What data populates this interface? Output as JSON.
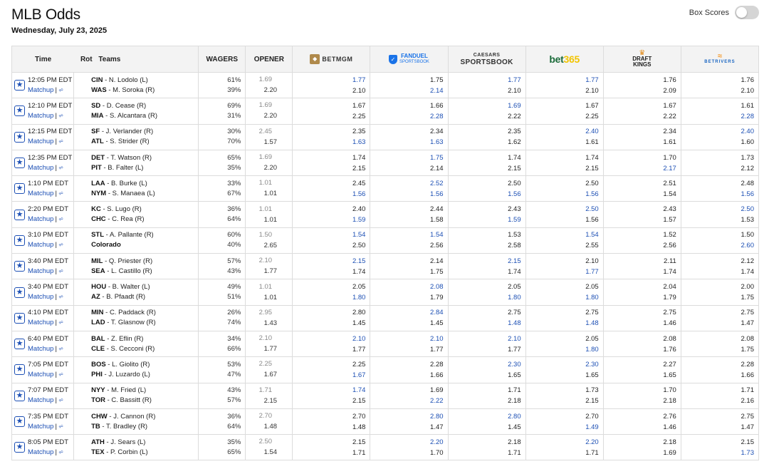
{
  "page": {
    "title": "MLB Odds",
    "date": "Wednesday, July 23, 2025"
  },
  "box_scores": {
    "label": "Box Scores",
    "enabled": false
  },
  "columns": {
    "time": "Time",
    "rot": "Rot",
    "teams": "Teams",
    "wagers": "WAGERS",
    "opener": "OPENER",
    "books": [
      {
        "name": "BetMGM",
        "icon": "betmgm-logo-icon",
        "text": "BETMGM"
      },
      {
        "name": "FanDuel Sportsbook",
        "icon": "fanduel-logo-icon",
        "text": "FANDUEL",
        "sub": "SPORTSBOOK"
      },
      {
        "name": "Caesars Sportsbook",
        "icon": "caesars-logo-icon",
        "text": "CAESARS",
        "sub": "SPORTSBOOK"
      },
      {
        "name": "bet365",
        "icon": "bet365-logo-icon",
        "text": "bet",
        "sub": "365"
      },
      {
        "name": "DraftKings",
        "icon": "draftkings-logo-icon",
        "text": "DRAFT",
        "sub": "KINGS"
      },
      {
        "name": "BetRivers",
        "icon": "betrivers-logo-icon",
        "text": "BETRIVERS"
      }
    ]
  },
  "matchup_label": "Matchup",
  "colors": {
    "accent": "#1c4fb4",
    "header_bg": "#f3f3f3",
    "border": "#dcdcdc"
  },
  "games": [
    {
      "time": "12:05 PM EDT",
      "away": {
        "abbr": "CIN",
        "pitcher": " - N. Lodolo (L)"
      },
      "home": {
        "abbr": "WAS",
        "pitcher": " - M. Soroka (R)"
      },
      "wagers": [
        "61%",
        "39%"
      ],
      "opener": [
        "1.69",
        "2.20"
      ],
      "odds": [
        [
          "1.77",
          "2.10"
        ],
        [
          "1.75",
          "2.14"
        ],
        [
          "1.77",
          "2.10"
        ],
        [
          "1.77",
          "2.10"
        ],
        [
          "1.76",
          "2.09"
        ],
        [
          "1.76",
          "2.10"
        ]
      ],
      "best": [
        [
          1,
          0
        ],
        [
          0,
          1
        ],
        [
          1,
          0
        ],
        [
          1,
          0
        ],
        [
          0,
          0
        ],
        [
          0,
          0
        ]
      ]
    },
    {
      "time": "12:10 PM EDT",
      "away": {
        "abbr": "SD",
        "pitcher": " - D. Cease (R)"
      },
      "home": {
        "abbr": "MIA",
        "pitcher": " - S. Alcantara (R)"
      },
      "wagers": [
        "69%",
        "31%"
      ],
      "opener": [
        "1.69",
        "2.20"
      ],
      "odds": [
        [
          "1.67",
          "2.25"
        ],
        [
          "1.66",
          "2.28"
        ],
        [
          "1.69",
          "2.22"
        ],
        [
          "1.67",
          "2.25"
        ],
        [
          "1.67",
          "2.22"
        ],
        [
          "1.61",
          "2.28"
        ]
      ],
      "best": [
        [
          0,
          0
        ],
        [
          0,
          1
        ],
        [
          1,
          0
        ],
        [
          0,
          0
        ],
        [
          0,
          0
        ],
        [
          0,
          1
        ]
      ]
    },
    {
      "time": "12:15 PM EDT",
      "away": {
        "abbr": "SF",
        "pitcher": " - J. Verlander (R)"
      },
      "home": {
        "abbr": "ATL",
        "pitcher": " - S. Strider (R)"
      },
      "wagers": [
        "30%",
        "70%"
      ],
      "opener": [
        "2.45",
        "1.57"
      ],
      "odds": [
        [
          "2.35",
          "1.63"
        ],
        [
          "2.34",
          "1.63"
        ],
        [
          "2.35",
          "1.62"
        ],
        [
          "2.40",
          "1.61"
        ],
        [
          "2.34",
          "1.61"
        ],
        [
          "2.40",
          "1.60"
        ]
      ],
      "best": [
        [
          0,
          1
        ],
        [
          0,
          1
        ],
        [
          0,
          0
        ],
        [
          1,
          0
        ],
        [
          0,
          0
        ],
        [
          1,
          0
        ]
      ]
    },
    {
      "time": "12:35 PM EDT",
      "away": {
        "abbr": "DET",
        "pitcher": " - T. Watson (R)"
      },
      "home": {
        "abbr": "PIT",
        "pitcher": " - B. Falter (L)"
      },
      "wagers": [
        "65%",
        "35%"
      ],
      "opener": [
        "1.69",
        "2.20"
      ],
      "odds": [
        [
          "1.74",
          "2.15"
        ],
        [
          "1.75",
          "2.14"
        ],
        [
          "1.74",
          "2.15"
        ],
        [
          "1.74",
          "2.15"
        ],
        [
          "1.70",
          "2.17"
        ],
        [
          "1.73",
          "2.12"
        ]
      ],
      "best": [
        [
          0,
          0
        ],
        [
          1,
          0
        ],
        [
          0,
          0
        ],
        [
          0,
          0
        ],
        [
          0,
          1
        ],
        [
          0,
          0
        ]
      ]
    },
    {
      "time": "1:10 PM EDT",
      "away": {
        "abbr": "LAA",
        "pitcher": " - B. Burke (L)"
      },
      "home": {
        "abbr": "NYM",
        "pitcher": " - S. Manaea (L)"
      },
      "wagers": [
        "33%",
        "67%"
      ],
      "opener": [
        "1.01",
        "1.01"
      ],
      "odds": [
        [
          "2.45",
          "1.56"
        ],
        [
          "2.52",
          "1.56"
        ],
        [
          "2.50",
          "1.56"
        ],
        [
          "2.50",
          "1.56"
        ],
        [
          "2.51",
          "1.54"
        ],
        [
          "2.48",
          "1.56"
        ]
      ],
      "best": [
        [
          0,
          1
        ],
        [
          1,
          1
        ],
        [
          0,
          1
        ],
        [
          0,
          1
        ],
        [
          0,
          0
        ],
        [
          0,
          1
        ]
      ]
    },
    {
      "time": "2:20 PM EDT",
      "away": {
        "abbr": "KC",
        "pitcher": " - S. Lugo (R)"
      },
      "home": {
        "abbr": "CHC",
        "pitcher": " - C. Rea (R)"
      },
      "wagers": [
        "36%",
        "64%"
      ],
      "opener": [
        "1.01",
        "1.01"
      ],
      "odds": [
        [
          "2.40",
          "1.59"
        ],
        [
          "2.44",
          "1.58"
        ],
        [
          "2.43",
          "1.59"
        ],
        [
          "2.50",
          "1.56"
        ],
        [
          "2.43",
          "1.57"
        ],
        [
          "2.50",
          "1.53"
        ]
      ],
      "best": [
        [
          0,
          1
        ],
        [
          0,
          0
        ],
        [
          0,
          1
        ],
        [
          1,
          0
        ],
        [
          0,
          0
        ],
        [
          1,
          0
        ]
      ]
    },
    {
      "time": "3:10 PM EDT",
      "away": {
        "abbr": "STL",
        "pitcher": " - A. Pallante (R)"
      },
      "home": {
        "abbr": "Colorado",
        "pitcher": ""
      },
      "wagers": [
        "60%",
        "40%"
      ],
      "opener": [
        "1.50",
        "2.65"
      ],
      "odds": [
        [
          "1.54",
          "2.50"
        ],
        [
          "1.54",
          "2.56"
        ],
        [
          "1.53",
          "2.58"
        ],
        [
          "1.54",
          "2.55"
        ],
        [
          "1.52",
          "2.56"
        ],
        [
          "1.50",
          "2.60"
        ]
      ],
      "best": [
        [
          1,
          0
        ],
        [
          1,
          0
        ],
        [
          0,
          0
        ],
        [
          1,
          0
        ],
        [
          0,
          0
        ],
        [
          0,
          1
        ]
      ]
    },
    {
      "time": "3:40 PM EDT",
      "away": {
        "abbr": "MIL",
        "pitcher": " - Q. Priester (R)"
      },
      "home": {
        "abbr": "SEA",
        "pitcher": " - L. Castillo (R)"
      },
      "wagers": [
        "57%",
        "43%"
      ],
      "opener": [
        "2.10",
        "1.77"
      ],
      "odds": [
        [
          "2.15",
          "1.74"
        ],
        [
          "2.14",
          "1.75"
        ],
        [
          "2.15",
          "1.74"
        ],
        [
          "2.10",
          "1.77"
        ],
        [
          "2.11",
          "1.74"
        ],
        [
          "2.12",
          "1.74"
        ]
      ],
      "best": [
        [
          1,
          0
        ],
        [
          0,
          0
        ],
        [
          1,
          0
        ],
        [
          0,
          1
        ],
        [
          0,
          0
        ],
        [
          0,
          0
        ]
      ]
    },
    {
      "time": "3:40 PM EDT",
      "away": {
        "abbr": "HOU",
        "pitcher": " - B. Walter (L)"
      },
      "home": {
        "abbr": "AZ",
        "pitcher": " - B. Pfaadt (R)"
      },
      "wagers": [
        "49%",
        "51%"
      ],
      "opener": [
        "1.01",
        "1.01"
      ],
      "odds": [
        [
          "2.05",
          "1.80"
        ],
        [
          "2.08",
          "1.79"
        ],
        [
          "2.05",
          "1.80"
        ],
        [
          "2.05",
          "1.80"
        ],
        [
          "2.04",
          "1.79"
        ],
        [
          "2.00",
          "1.75"
        ]
      ],
      "best": [
        [
          0,
          1
        ],
        [
          1,
          0
        ],
        [
          0,
          1
        ],
        [
          0,
          1
        ],
        [
          0,
          0
        ],
        [
          0,
          0
        ]
      ]
    },
    {
      "time": "4:10 PM EDT",
      "away": {
        "abbr": "MIN",
        "pitcher": " - C. Paddack (R)"
      },
      "home": {
        "abbr": "LAD",
        "pitcher": " - T. Glasnow (R)"
      },
      "wagers": [
        "26%",
        "74%"
      ],
      "opener": [
        "2.95",
        "1.43"
      ],
      "odds": [
        [
          "2.80",
          "1.45"
        ],
        [
          "2.84",
          "1.45"
        ],
        [
          "2.75",
          "1.48"
        ],
        [
          "2.75",
          "1.48"
        ],
        [
          "2.75",
          "1.46"
        ],
        [
          "2.75",
          "1.47"
        ]
      ],
      "best": [
        [
          0,
          0
        ],
        [
          1,
          0
        ],
        [
          0,
          1
        ],
        [
          0,
          1
        ],
        [
          0,
          0
        ],
        [
          0,
          0
        ]
      ]
    },
    {
      "time": "6:40 PM EDT",
      "away": {
        "abbr": "BAL",
        "pitcher": " - Z. Eflin (R)"
      },
      "home": {
        "abbr": "CLE",
        "pitcher": " - S. Cecconi (R)"
      },
      "wagers": [
        "34%",
        "66%"
      ],
      "opener": [
        "2.10",
        "1.77"
      ],
      "odds": [
        [
          "2.10",
          "1.77"
        ],
        [
          "2.10",
          "1.77"
        ],
        [
          "2.10",
          "1.77"
        ],
        [
          "2.05",
          "1.80"
        ],
        [
          "2.08",
          "1.76"
        ],
        [
          "2.08",
          "1.75"
        ]
      ],
      "best": [
        [
          1,
          0
        ],
        [
          1,
          0
        ],
        [
          1,
          0
        ],
        [
          0,
          1
        ],
        [
          0,
          0
        ],
        [
          0,
          0
        ]
      ]
    },
    {
      "time": "7:05 PM EDT",
      "away": {
        "abbr": "BOS",
        "pitcher": " - L. Giolito (R)"
      },
      "home": {
        "abbr": "PHI",
        "pitcher": " - J. Luzardo (L)"
      },
      "wagers": [
        "53%",
        "47%"
      ],
      "opener": [
        "2.25",
        "1.67"
      ],
      "odds": [
        [
          "2.25",
          "1.67"
        ],
        [
          "2.28",
          "1.66"
        ],
        [
          "2.30",
          "1.65"
        ],
        [
          "2.30",
          "1.65"
        ],
        [
          "2.27",
          "1.65"
        ],
        [
          "2.28",
          "1.66"
        ]
      ],
      "best": [
        [
          0,
          1
        ],
        [
          0,
          0
        ],
        [
          1,
          0
        ],
        [
          1,
          0
        ],
        [
          0,
          0
        ],
        [
          0,
          0
        ]
      ]
    },
    {
      "time": "7:07 PM EDT",
      "away": {
        "abbr": "NYY",
        "pitcher": " - M. Fried (L)"
      },
      "home": {
        "abbr": "TOR",
        "pitcher": " - C. Bassitt (R)"
      },
      "wagers": [
        "43%",
        "57%"
      ],
      "opener": [
        "1.71",
        "2.15"
      ],
      "odds": [
        [
          "1.74",
          "2.15"
        ],
        [
          "1.69",
          "2.22"
        ],
        [
          "1.71",
          "2.18"
        ],
        [
          "1.73",
          "2.15"
        ],
        [
          "1.70",
          "2.18"
        ],
        [
          "1.71",
          "2.16"
        ]
      ],
      "best": [
        [
          1,
          0
        ],
        [
          0,
          1
        ],
        [
          0,
          0
        ],
        [
          0,
          0
        ],
        [
          0,
          0
        ],
        [
          0,
          0
        ]
      ]
    },
    {
      "time": "7:35 PM EDT",
      "away": {
        "abbr": "CHW",
        "pitcher": " - J. Cannon (R)"
      },
      "home": {
        "abbr": "TB",
        "pitcher": " - T. Bradley (R)"
      },
      "wagers": [
        "36%",
        "64%"
      ],
      "opener": [
        "2.70",
        "1.48"
      ],
      "odds": [
        [
          "2.70",
          "1.48"
        ],
        [
          "2.80",
          "1.47"
        ],
        [
          "2.80",
          "1.45"
        ],
        [
          "2.70",
          "1.49"
        ],
        [
          "2.76",
          "1.46"
        ],
        [
          "2.75",
          "1.47"
        ]
      ],
      "best": [
        [
          0,
          0
        ],
        [
          1,
          0
        ],
        [
          1,
          0
        ],
        [
          0,
          1
        ],
        [
          0,
          0
        ],
        [
          0,
          0
        ]
      ]
    },
    {
      "time": "8:05 PM EDT",
      "away": {
        "abbr": "ATH",
        "pitcher": " - J. Sears (L)"
      },
      "home": {
        "abbr": "TEX",
        "pitcher": " - P. Corbin (L)"
      },
      "wagers": [
        "35%",
        "65%"
      ],
      "opener": [
        "2.50",
        "1.54"
      ],
      "odds": [
        [
          "2.15",
          "1.71"
        ],
        [
          "2.20",
          "1.70"
        ],
        [
          "2.18",
          "1.71"
        ],
        [
          "2.20",
          "1.71"
        ],
        [
          "2.18",
          "1.69"
        ],
        [
          "2.15",
          "1.73"
        ]
      ],
      "best": [
        [
          0,
          0
        ],
        [
          1,
          0
        ],
        [
          0,
          0
        ],
        [
          1,
          0
        ],
        [
          0,
          0
        ],
        [
          0,
          1
        ]
      ]
    }
  ]
}
